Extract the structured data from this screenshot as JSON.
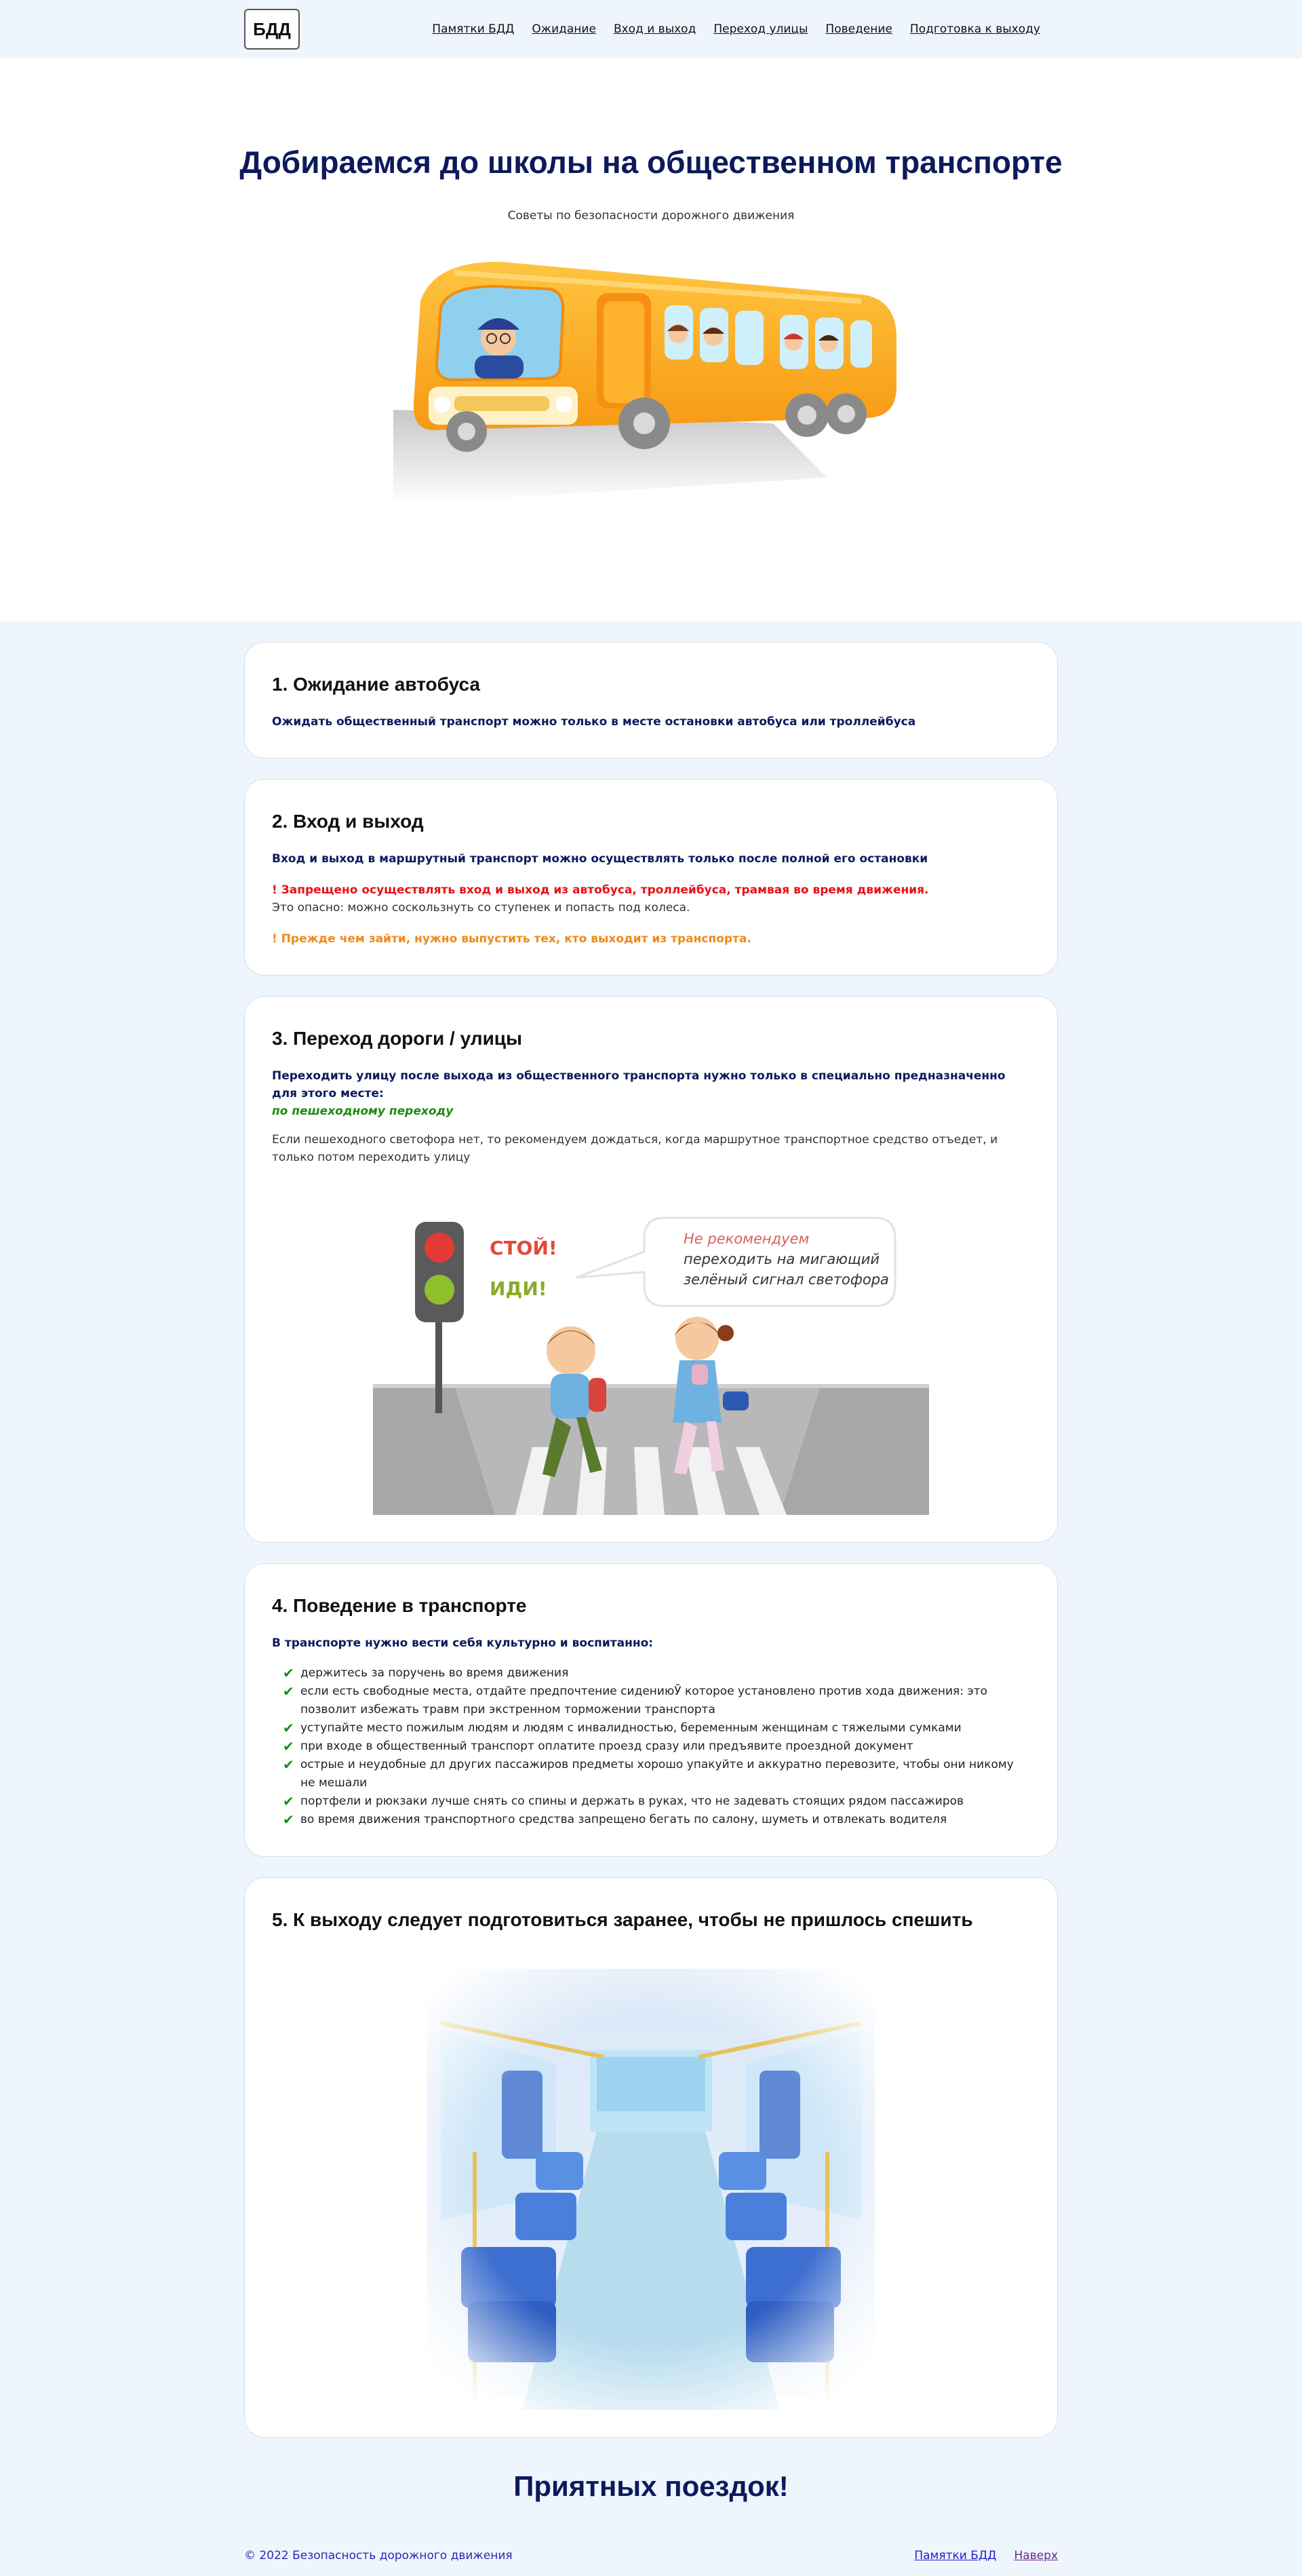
{
  "header": {
    "logo": "БДД",
    "nav": [
      "Памятки БДД",
      "Ожидание",
      "Вход и выход",
      "Переход улицы",
      "Поведение",
      "Подготовка к выходу"
    ]
  },
  "hero": {
    "title": "Добираемся до школы на общественном транспорте",
    "subtitle": "Советы по безопасности дорожного движения"
  },
  "sections": {
    "waiting": {
      "title": "1. Ожидание автобуса",
      "text": "Ожидать общественный транспорт можно только в месте остановки автобуса или троллейбуса"
    },
    "entry": {
      "title": "2. Вход и выход",
      "rule": "Вход и выход в маршрутный транспорт можно осуществлять только после полной его остановки",
      "warning": "! Запрещено осуществлять вход и выход из автобуса, троллейбуса, трамвая во время движения.",
      "danger": "Это опасно: можно соскользнуть со ступенек и попасть под колеса.",
      "tip": "! Прежде чем зайти, нужно выпустить тех, кто выходит из транспорта."
    },
    "crossing": {
      "title": "3. Переход дороги / улицы",
      "rule": "Переходить улицу после выхода из общественного транспорта нужно только в специально предназначенно для этого месте:",
      "place": "по пешеходному переходу",
      "advice": "Если пешеходного светофора нет, то рекомендуем дождаться, когда маршрутное транспортное средство отъедет, и только потом переходить улицу",
      "image": {
        "stop": "СТОЙ!",
        "go": "ИДИ!",
        "bubble_line1": "Не рекомендуем",
        "bubble_line2": "переходить на мигающий",
        "bubble_line3": "зелёный сигнал светофора"
      }
    },
    "behavior": {
      "title": "4. Поведение в транспорте",
      "intro": "В транспорте нужно вести себя культурно и воспитанно:",
      "items": [
        "держитесь за поручень во время движения",
        "если есть свободные места, отдайте предпочтение сидениюЎ которое установлено против хода движения: это позволит избежать травм при экстренном торможении транспорта",
        "уступайте место пожилым людям и людям с инвалидностью, беременным женщинам с тяжелыми сумками",
        "при входе в общественный транспорт оплатите проезд сразу или предъявите проездной документ",
        "острые и неудобные дл других пассажиров предметы хорошо упакуйте и аккуратно перевозите, чтобы они никому не мешали",
        "портфели и рюкзаки лучше снять со спины и держать в руках, что не задевать стоящих рядом пассажиров",
        "во время движения транспортного средства запрещено бегать по салону, шуметь и отвлекать водителя"
      ]
    },
    "exit": {
      "title": "5. К выходу следует подготовиться заранее, чтобы не пришлось спешить"
    }
  },
  "farewell": "Приятных поездок!",
  "footer": {
    "copyright": "© 2022 Безопасность дорожного движения",
    "links": [
      "Памятки БДД",
      "Наверх"
    ]
  },
  "colors": {
    "navy": "#0c1a5c",
    "red": "#e8101a",
    "orange": "#ef8a14",
    "green": "#1f8a12",
    "page_bg": "#eef5fd"
  }
}
